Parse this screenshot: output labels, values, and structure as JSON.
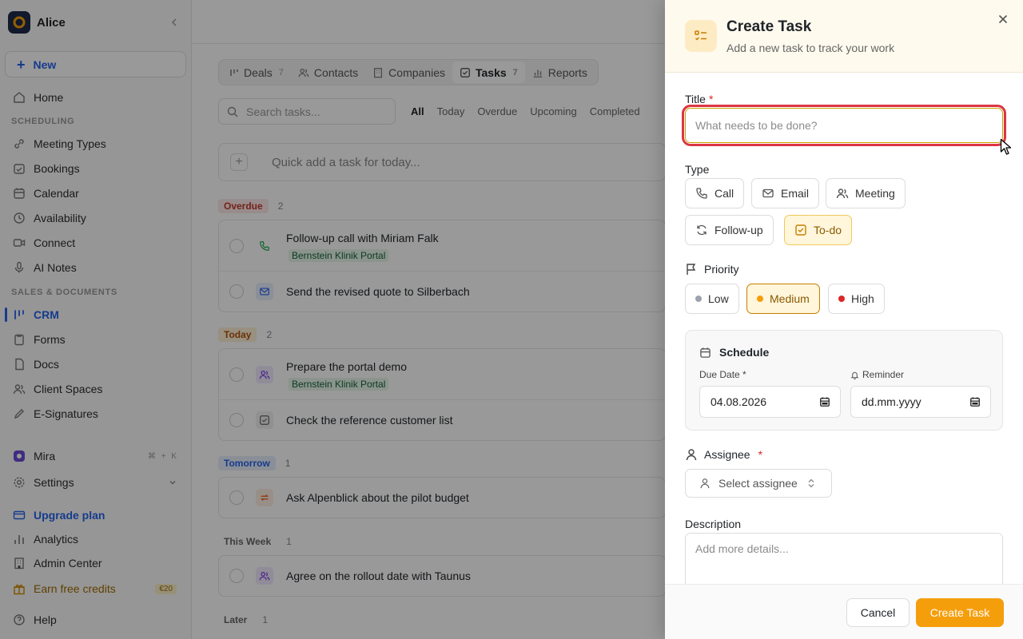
{
  "sidebar": {
    "workspace": "Alice",
    "new_label": "New",
    "sections": {
      "scheduling": "SCHEDULING",
      "sales": "SALES & DOCUMENTS"
    },
    "items": {
      "home": "Home",
      "meeting_types": "Meeting Types",
      "bookings": "Bookings",
      "calendar": "Calendar",
      "availability": "Availability",
      "connect": "Connect",
      "ai_notes": "AI Notes",
      "crm": "CRM",
      "forms": "Forms",
      "docs": "Docs",
      "client_spaces": "Client Spaces",
      "esignatures": "E-Signatures",
      "mira": "Mira",
      "mira_shortcut": "⌘ + K",
      "settings": "Settings",
      "upgrade": "Upgrade plan",
      "analytics": "Analytics",
      "admin": "Admin Center",
      "credits": "Earn free credits",
      "credits_badge": "€20",
      "help": "Help"
    }
  },
  "main": {
    "tabs": [
      {
        "label": "Deals",
        "count": "7"
      },
      {
        "label": "Contacts",
        "count": ""
      },
      {
        "label": "Companies",
        "count": ""
      },
      {
        "label": "Tasks",
        "count": "7"
      },
      {
        "label": "Reports",
        "count": ""
      }
    ],
    "search_placeholder": "Search tasks...",
    "filters": [
      "All",
      "Today",
      "Overdue",
      "Upcoming",
      "Completed"
    ],
    "quick_add": "Quick add a task for today...",
    "groups": {
      "overdue": {
        "label": "Overdue",
        "count": "2"
      },
      "today": {
        "label": "Today",
        "count": "2"
      },
      "tomorrow": {
        "label": "Tomorrow",
        "count": "1"
      },
      "this_week": {
        "label": "This Week",
        "count": "1"
      },
      "later": {
        "label": "Later",
        "count": "1"
      }
    },
    "tasks": {
      "t1": {
        "title": "Follow-up call with Miriam Falk",
        "tag": "Bernstein Klinik Portal"
      },
      "t2": {
        "title": "Send the revised quote to Silberbach"
      },
      "t3": {
        "title": "Prepare the portal demo",
        "tag": "Bernstein Klinik Portal"
      },
      "t4": {
        "title": "Check the reference customer list"
      },
      "t5": {
        "title": "Ask Alpenblick about the pilot budget"
      },
      "t6": {
        "title": "Agree on the rollout date with Taunus"
      }
    }
  },
  "dialog": {
    "title": "Create Task",
    "subtitle": "Add a new task to track your work",
    "title_label": "Title",
    "required_mark": "*",
    "title_placeholder": "What needs to be done?",
    "type_label": "Type",
    "types": {
      "call": "Call",
      "email": "Email",
      "meeting": "Meeting",
      "followup": "Follow-up",
      "todo": "To-do"
    },
    "selected_type": "To-do",
    "priority_label": "Priority",
    "priorities": {
      "low": "Low",
      "medium": "Medium",
      "high": "High"
    },
    "selected_priority": "Medium",
    "schedule_label": "Schedule",
    "due_label": "Due Date *",
    "due_value": "04.08.2026",
    "reminder_label": "Reminder",
    "reminder_value": "dd.mm.yyyy",
    "assignee_label": "Assignee",
    "assignee_placeholder": "Select assignee",
    "description_label": "Description",
    "description_placeholder": "Add more details...",
    "cancel": "Cancel",
    "create": "Create Task"
  },
  "colors": {
    "accent": "#f59e0b",
    "link": "#2563eb",
    "error_outline": "#dc3545",
    "priority_low": "#9ca3af",
    "priority_medium": "#f59e0b",
    "priority_high": "#dc2626"
  }
}
